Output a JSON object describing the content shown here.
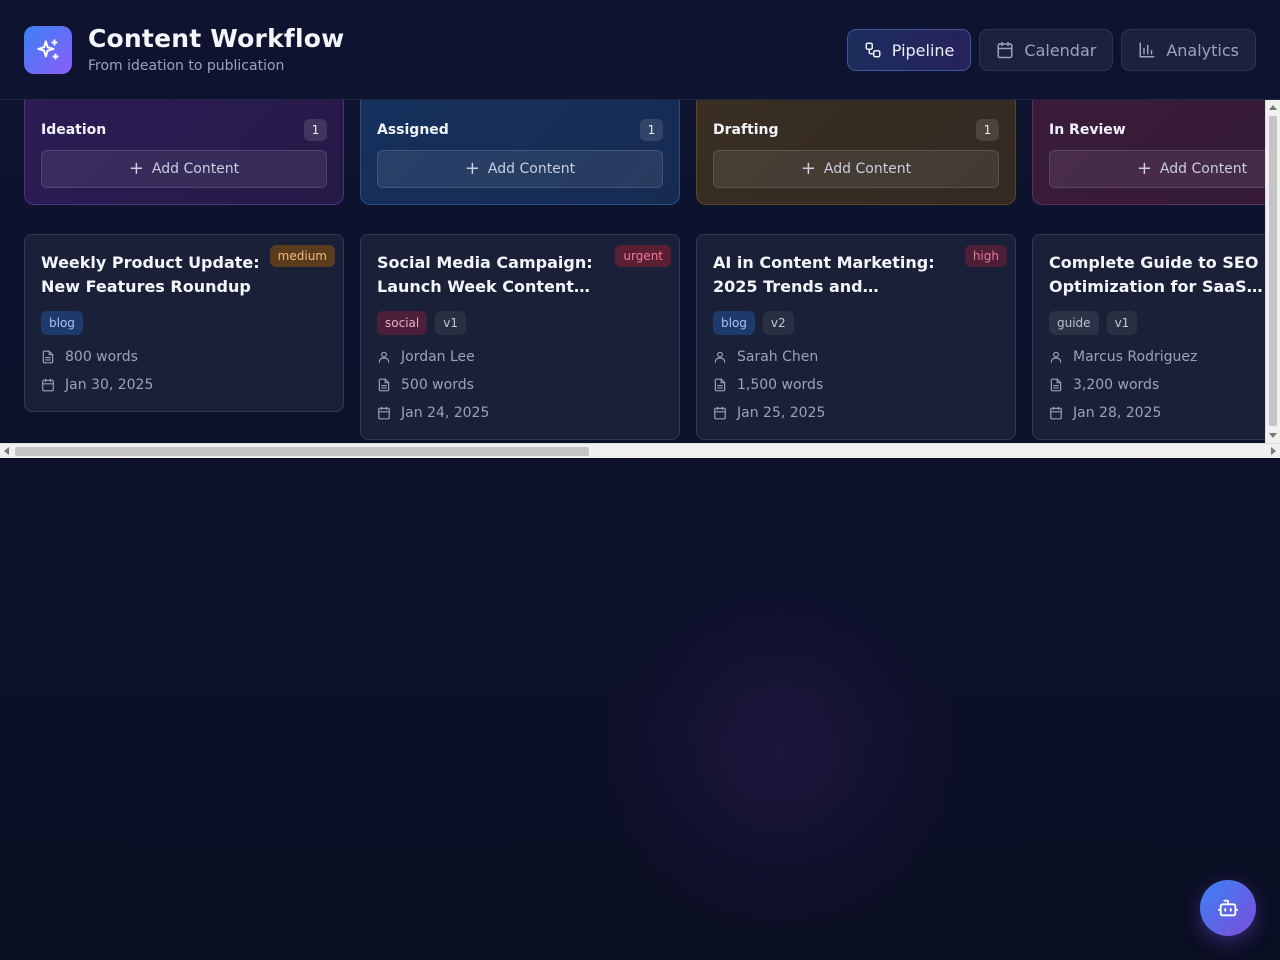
{
  "header": {
    "title": "Content Workflow",
    "subtitle": "From ideation to publication",
    "logo_icon": "sparkles-icon",
    "nav": [
      {
        "label": "Pipeline",
        "icon": "workflow-icon",
        "active": true
      },
      {
        "label": "Calendar",
        "icon": "calendar-icon",
        "active": false
      },
      {
        "label": "Analytics",
        "icon": "bar-chart-icon",
        "active": false
      }
    ]
  },
  "columns": [
    {
      "title": "Ideation",
      "count": "1",
      "add_label": "Add Content",
      "color": "#2b1c54",
      "card": {
        "title": "Weekly Product Update: New Features Roundup",
        "priority": "medium",
        "tags": [
          "blog"
        ],
        "words": "800 words",
        "date": "Jan 30, 2025"
      }
    },
    {
      "title": "Assigned",
      "count": "1",
      "add_label": "Add Content",
      "color": "#15305d",
      "card": {
        "title": "Social Media Campaign: Launch Week Content…",
        "priority": "urgent",
        "tags": [
          "social",
          "v1"
        ],
        "assignee": "Jordan Lee",
        "words": "500 words",
        "date": "Jan 24, 2025"
      }
    },
    {
      "title": "Drafting",
      "count": "1",
      "add_label": "Add Content",
      "color": "#3a2e22",
      "card": {
        "title": "AI in Content Marketing: 2025 Trends and…",
        "priority": "high",
        "tags": [
          "blog",
          "v2"
        ],
        "assignee": "Sarah Chen",
        "words": "1,500 words",
        "date": "Jan 25, 2025"
      }
    },
    {
      "title": "In Review",
      "add_label": "Add Content",
      "color": "#3a1c3a",
      "card": {
        "title": "Complete Guide to SEO Optimization for SaaS…",
        "tags": [
          "guide",
          "v1"
        ],
        "assignee": "Marcus Rodriguez",
        "words": "3,200 words",
        "date": "Jan 28, 2025"
      }
    }
  ],
  "assistant": {
    "icon": "bot-icon"
  }
}
